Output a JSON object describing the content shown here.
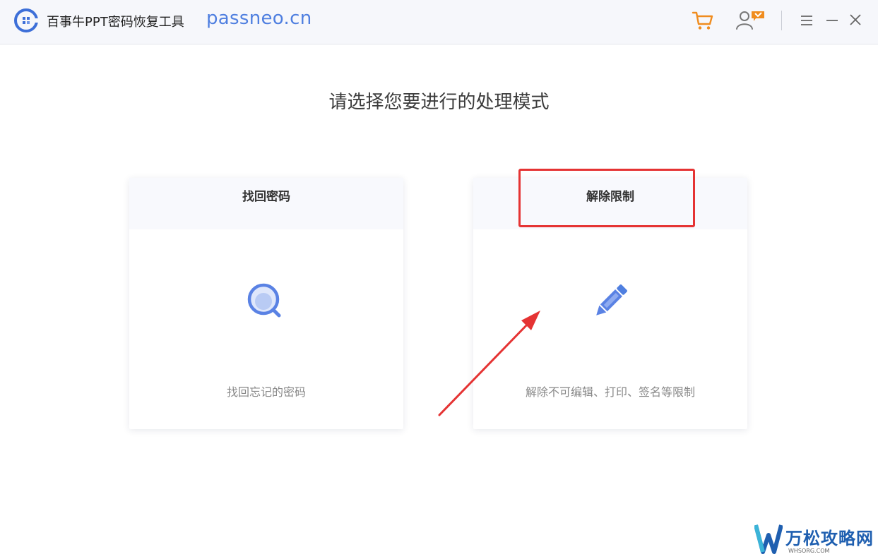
{
  "window": {
    "app_title": "百事牛PPT密码恢复工具",
    "url": "passneo.cn"
  },
  "colors": {
    "accent": "#4f7fe0",
    "cart_orange": "#f08c1e",
    "annotation_red": "#e53333"
  },
  "icons": {
    "app_logo": "app-logo-icon",
    "cart": "shopping-cart-icon",
    "user": "user-account-icon",
    "menu": "menu-icon",
    "minimize": "minimize-icon",
    "close": "close-icon",
    "recover": "magnifier-icon",
    "remove": "pencil-icon"
  },
  "main": {
    "prompt": "请选择您要进行的处理模式"
  },
  "modes": [
    {
      "title": "找回密码",
      "description": "找回忘记的密码"
    },
    {
      "title": "解除限制",
      "description": "解除不可编辑、打印、签名等限制"
    }
  ],
  "watermark": {
    "text": "万松攻略网",
    "sub": "WHSORG.COM"
  }
}
